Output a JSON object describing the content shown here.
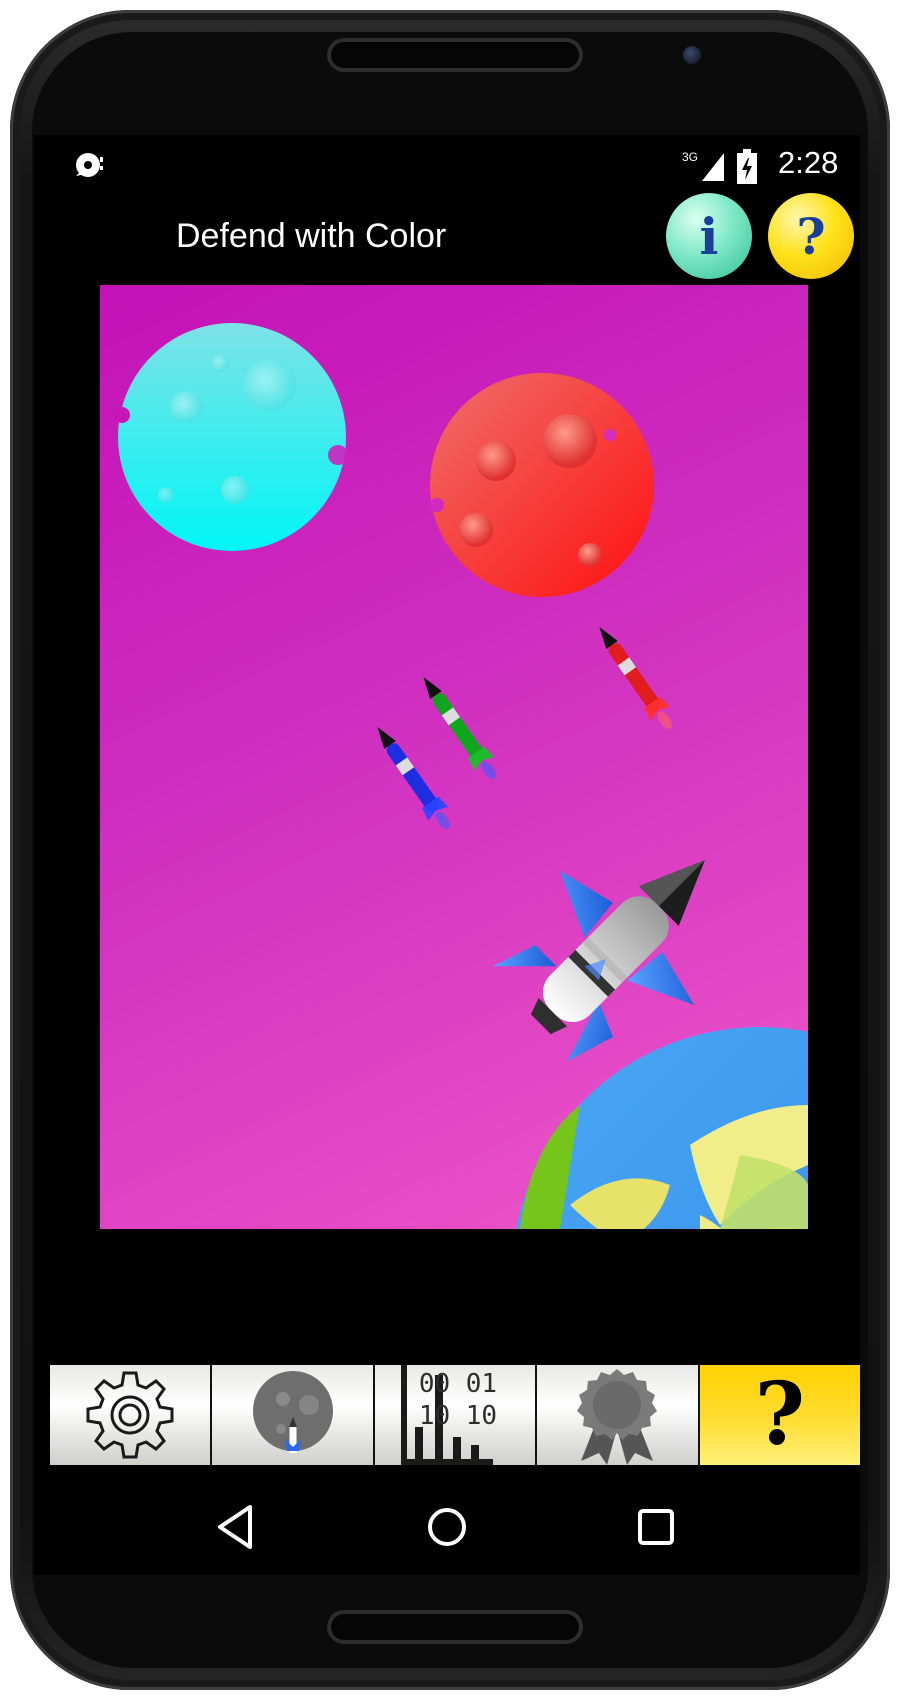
{
  "status_bar": {
    "network": "3G",
    "time": "2:28"
  },
  "app": {
    "title": "Defend with Color",
    "info_button_glyph": "i",
    "help_button_glyph": "?"
  },
  "game": {
    "background_gradient": [
      "#c412b6",
      "#ee58c8"
    ],
    "planets": [
      {
        "name": "cyan-moon",
        "color": "#00f0f0"
      },
      {
        "name": "red-moon",
        "color": "#ff2a2a"
      },
      {
        "name": "earth",
        "color": "#3d9df2"
      }
    ],
    "missiles": [
      {
        "color": "#1c2ee0"
      },
      {
        "color": "#0fa51c"
      },
      {
        "color": "#e01c1c"
      }
    ],
    "player_ship": "rocket-icon"
  },
  "tabs": [
    {
      "name": "settings",
      "icon": "gear-icon"
    },
    {
      "name": "play",
      "icon": "moon-rocket-icon"
    },
    {
      "name": "scores",
      "icon": "stats-icon",
      "text_top": "00  01",
      "text_bottom": "10  10"
    },
    {
      "name": "achievements",
      "icon": "award-ribbon-icon"
    },
    {
      "name": "help",
      "icon": "question-icon",
      "glyph": "?",
      "color": "#ffd200"
    }
  ],
  "nav": {
    "back": "back-icon",
    "home": "home-icon",
    "recents": "recents-icon"
  }
}
